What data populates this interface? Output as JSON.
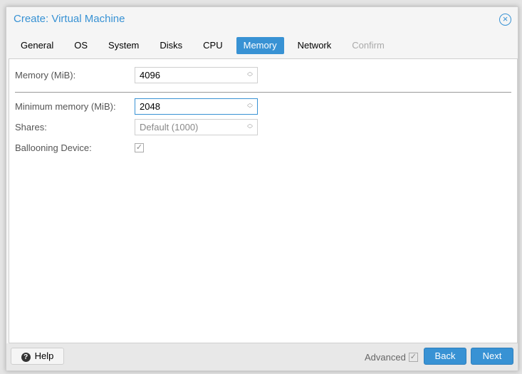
{
  "dialog": {
    "title": "Create: Virtual Machine",
    "close_icon": "close-circle-icon"
  },
  "tabs": [
    {
      "label": "General"
    },
    {
      "label": "OS"
    },
    {
      "label": "System"
    },
    {
      "label": "Disks"
    },
    {
      "label": "CPU"
    },
    {
      "label": "Memory",
      "active": true
    },
    {
      "label": "Network"
    },
    {
      "label": "Confirm",
      "disabled": true
    }
  ],
  "form": {
    "memory": {
      "label": "Memory (MiB):",
      "value": "4096"
    },
    "min_memory": {
      "label": "Minimum memory (MiB):",
      "value": "2048"
    },
    "shares": {
      "label": "Shares:",
      "placeholder": "Default (1000)"
    },
    "ballooning": {
      "label": "Ballooning Device:",
      "checked": true
    }
  },
  "footer": {
    "help": "Help",
    "advanced": "Advanced",
    "advanced_checked": true,
    "back": "Back",
    "next": "Next"
  },
  "colors": {
    "accent": "#3892d4"
  }
}
